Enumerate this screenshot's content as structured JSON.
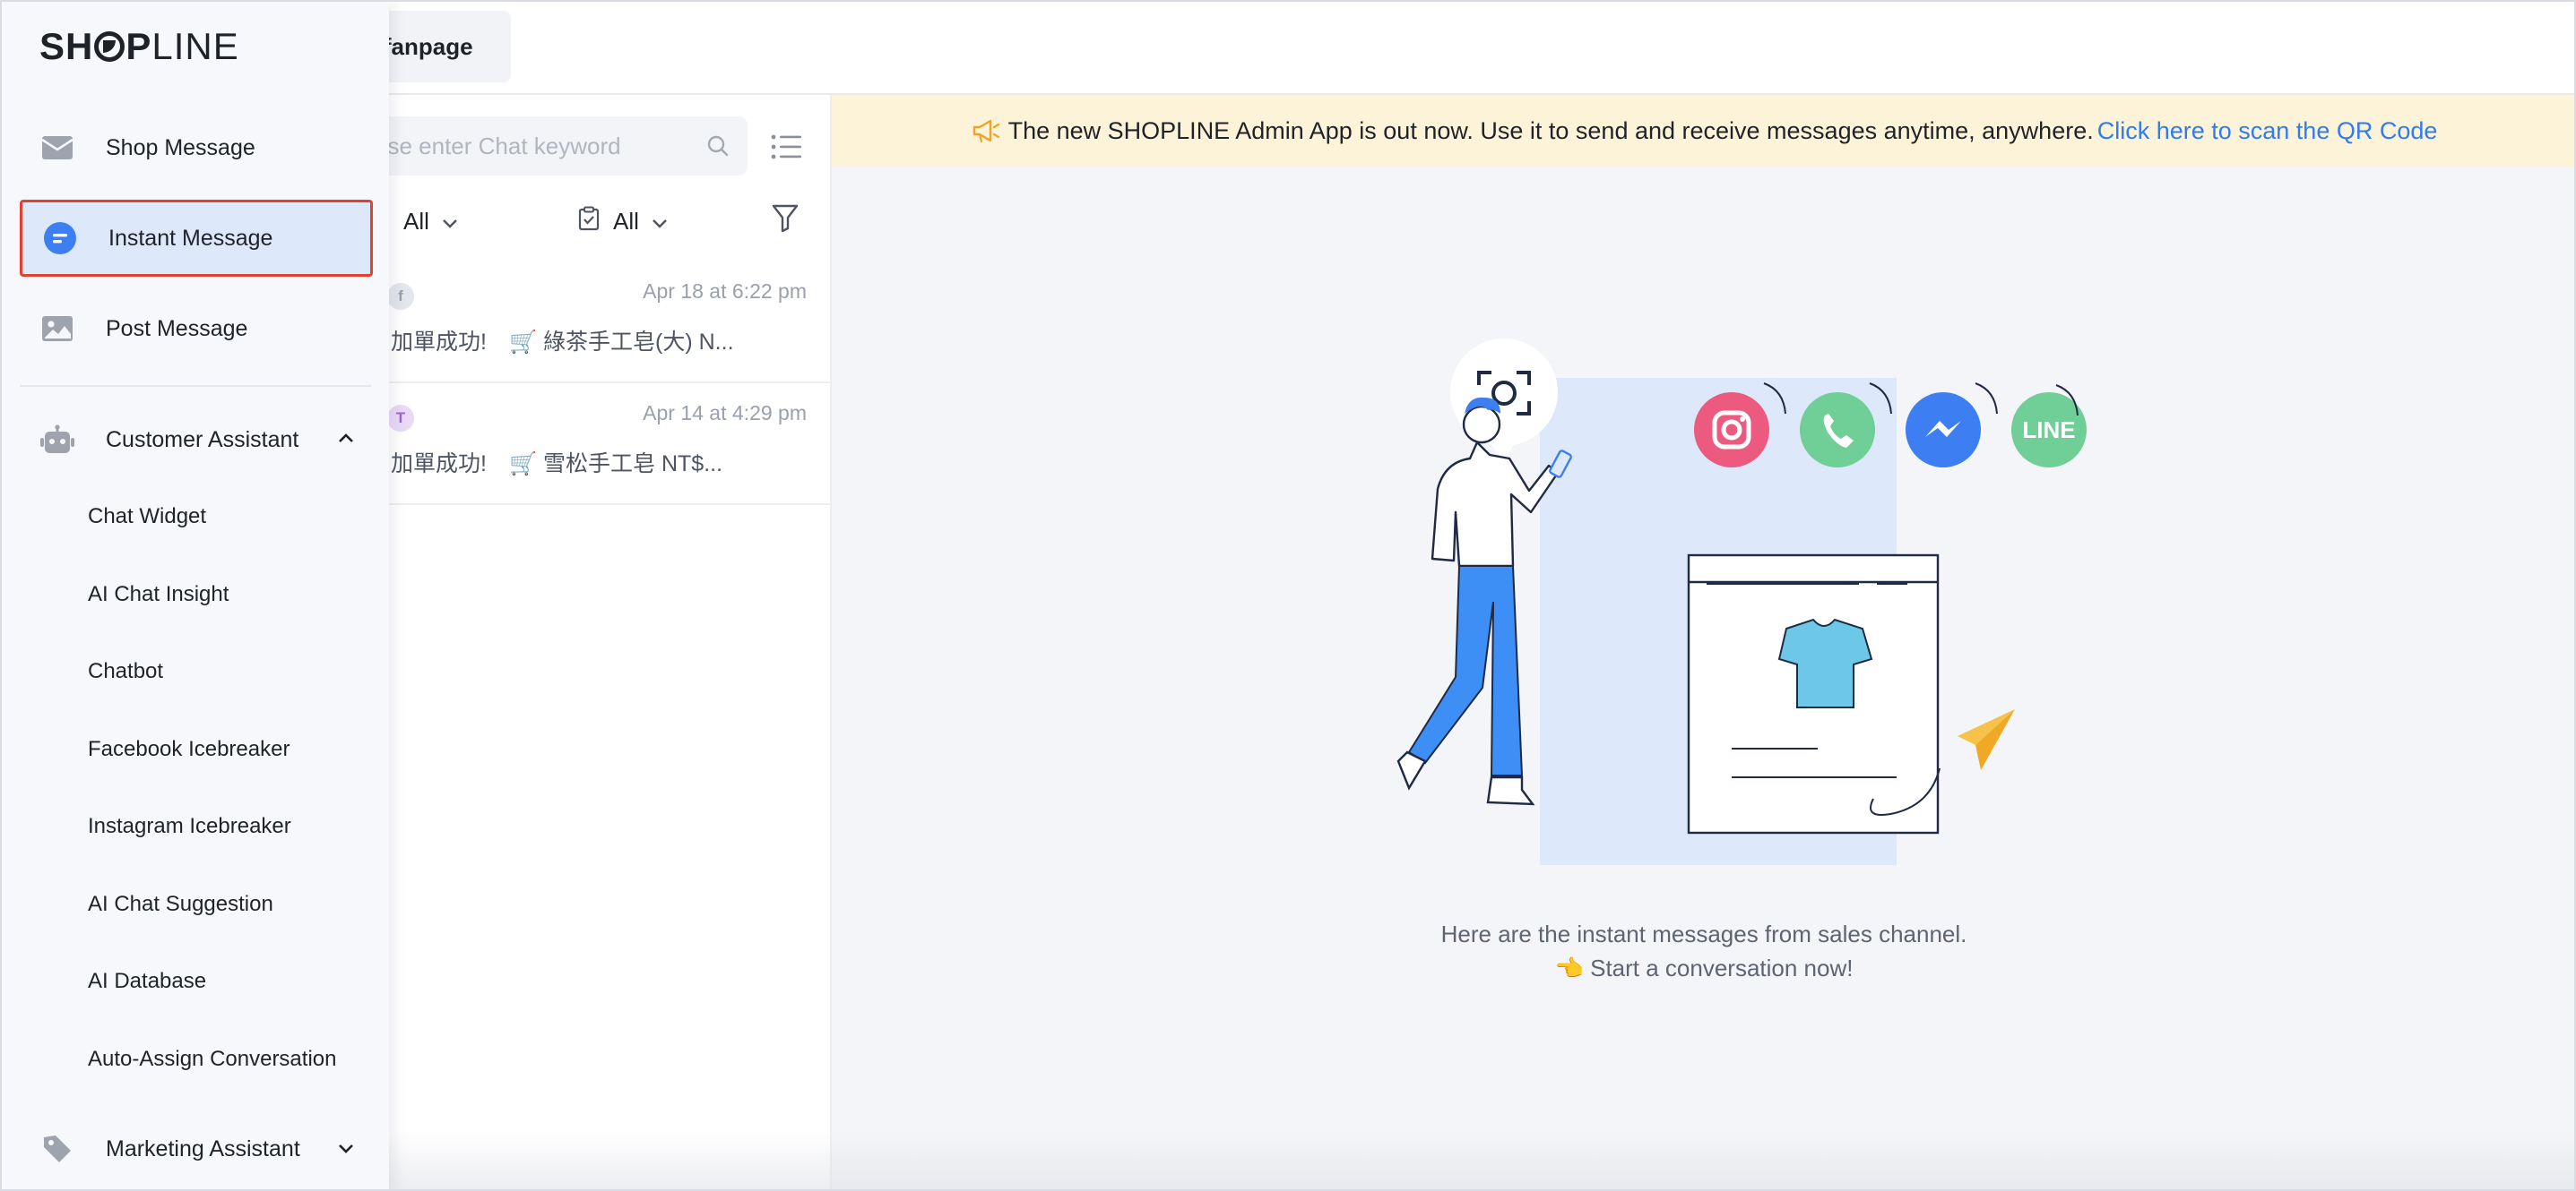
{
  "app": {
    "logo_bold": "SH",
    "logo_bold2": "P",
    "logo_thin": "LINE"
  },
  "topbar": {
    "fanpage_label": "t fanpage"
  },
  "sidebar": {
    "items": [
      {
        "label": "Shop Message"
      },
      {
        "label": "Instant Message",
        "active": true
      },
      {
        "label": "Post Message"
      }
    ],
    "customer_assistant": {
      "label": "Customer Assistant",
      "expanded": true,
      "subitems": [
        "Chat Widget",
        "AI Chat Insight",
        "Chatbot",
        "Facebook Icebreaker",
        "Instagram Icebreaker",
        "AI Chat Suggestion",
        "AI Database",
        "Auto-Assign Conversation"
      ]
    },
    "marketing_assistant": {
      "label": "Marketing Assistant",
      "expanded": false
    }
  },
  "list": {
    "search_placeholder": "ase enter Chat keyword",
    "filters": [
      {
        "label": "All"
      },
      {
        "label": "All"
      }
    ],
    "conversations": [
      {
        "avatar": "f",
        "time": "Apr 18 at 6:22 pm",
        "preview": "加單成功!　🛒 綠茶手工皂(大) N..."
      },
      {
        "avatar": "T",
        "time": "Apr 14 at 4:29 pm",
        "preview": "加單成功!　🛒 雪松手工皂 NT$..."
      }
    ]
  },
  "banner": {
    "text": "The new SHOPLINE Admin App is out now. Use it to send and receive messages anytime, anywhere.",
    "link": "Click here to scan the QR Code"
  },
  "empty_state": {
    "line1": "Here are the instant messages from sales channel.",
    "line2": "👈 Start a conversation now!",
    "line_logo_text": "LINE"
  },
  "colors": {
    "accent": "#2f7bf0",
    "active_bg": "#dde8fb",
    "highlight_border": "#e2412d",
    "banner_bg": "#fdf3d8"
  }
}
